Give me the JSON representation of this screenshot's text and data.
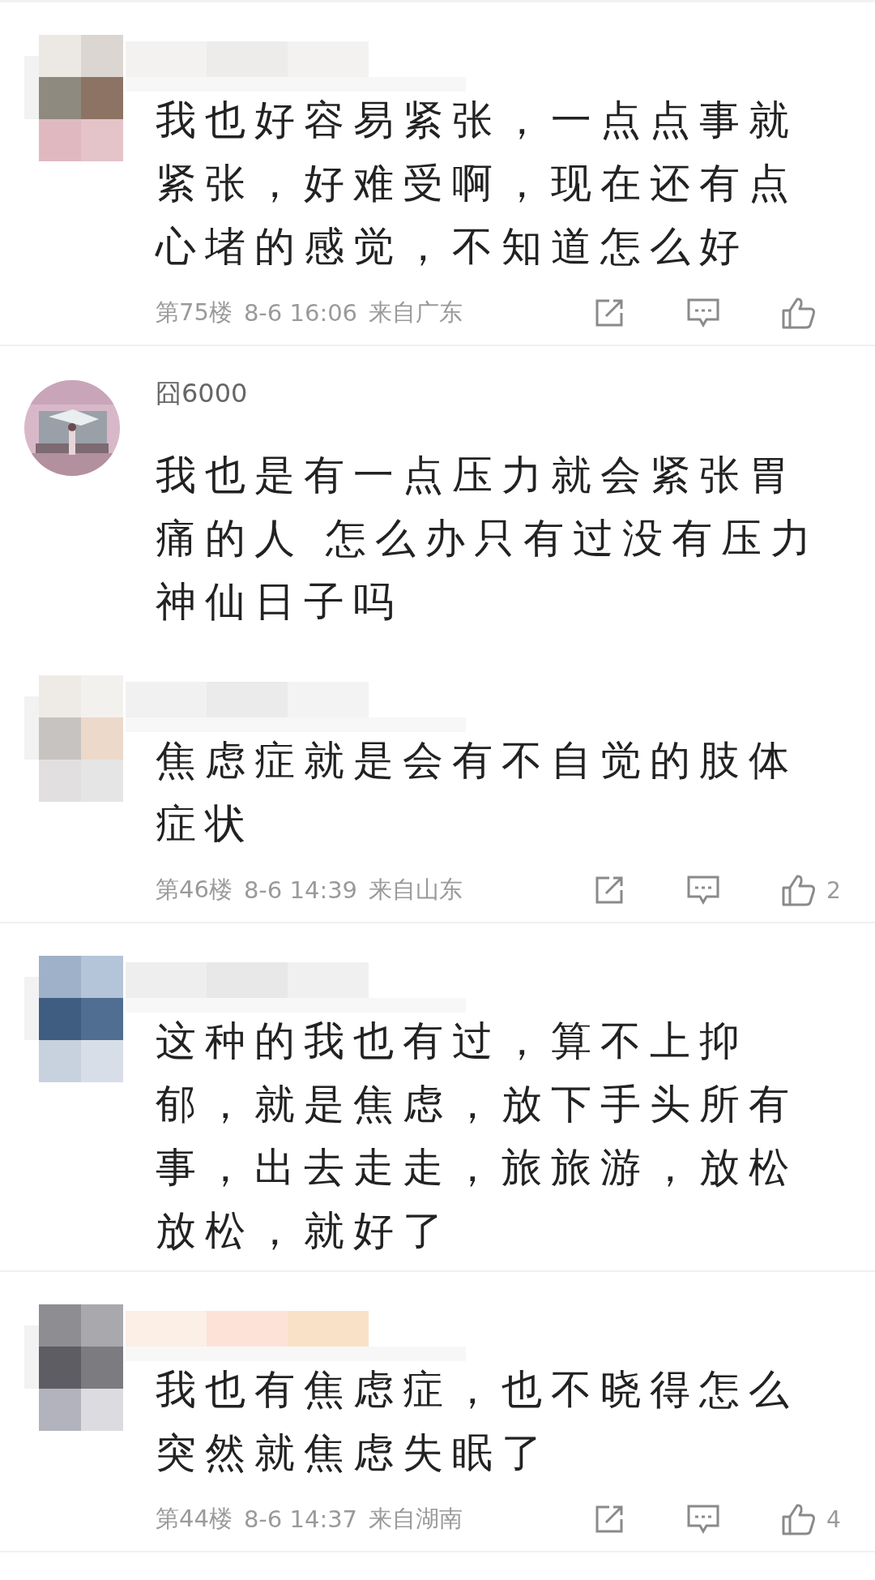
{
  "comments": [
    {
      "author": {
        "kind": "mosaic"
      },
      "text": "我也好容易紧张，一点点事就紧张，好难受啊，现在还有点心堵的感觉，不知道怎么好",
      "meta": {
        "floor": "第75楼",
        "time": "8-6 16:06",
        "location": "来自广东"
      }
    },
    {
      "author": {
        "name": "囧6000"
      },
      "text": "我也是有一点压力就会紧张胃痛的人 怎么办只有过没有压力神仙日子吗"
    },
    {
      "author": {
        "kind": "mosaic"
      },
      "text": "焦虑症就是会有不自觉的肢体症状",
      "meta": {
        "floor": "第46楼",
        "time": "8-6 14:39",
        "location": "来自山东",
        "likes": "2"
      }
    },
    {
      "author": {
        "kind": "mosaic"
      },
      "text": "这种的我也有过，算不上抑郁，就是焦虑，放下手头所有事，出去走走，旅旅游，放松放松，就好了"
    },
    {
      "author": {
        "kind": "mosaic"
      },
      "text": "我也有焦虑症，也不晓得怎么突然就焦虑失眠了",
      "meta": {
        "floor": "第44楼",
        "time": "8-6 14:37",
        "location": "来自湖南",
        "likes": "4"
      }
    }
  ]
}
